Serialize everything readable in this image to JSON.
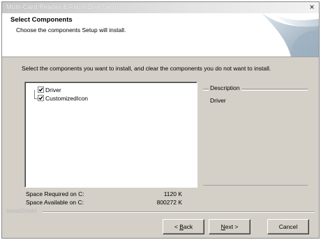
{
  "window": {
    "title": "Multi-Card Reader & Flash Disk Setup",
    "close_glyph": "×"
  },
  "header": {
    "title": "Select Components",
    "subtitle": "Choose the components Setup will install."
  },
  "instructions": "Select the components you want to install, and clear the components you do not want to install.",
  "components": [
    {
      "label": "Driver",
      "checked": true
    },
    {
      "label": "CustomizedIcon",
      "checked": true
    }
  ],
  "description": {
    "legend": "Description",
    "text": "Driver"
  },
  "space": {
    "required_label": "Space Required on  C:",
    "required_value": "1120 K",
    "available_label": "Space Available on  C:",
    "available_value": "800272 K"
  },
  "brand_text": "InstallShield",
  "buttons": {
    "back_prefix": "< ",
    "back_mnemonic": "B",
    "back_rest": "ack",
    "next_mnemonic": "N",
    "next_rest": "ext >",
    "cancel": "Cancel"
  },
  "colors": {
    "dialog_face": "#d4d0c8",
    "header_bg": "#ffffff"
  },
  "icons": {
    "close": "close-icon",
    "checkbox": "checkbox-checked-icon",
    "banner": "setup-banner-graphic"
  }
}
